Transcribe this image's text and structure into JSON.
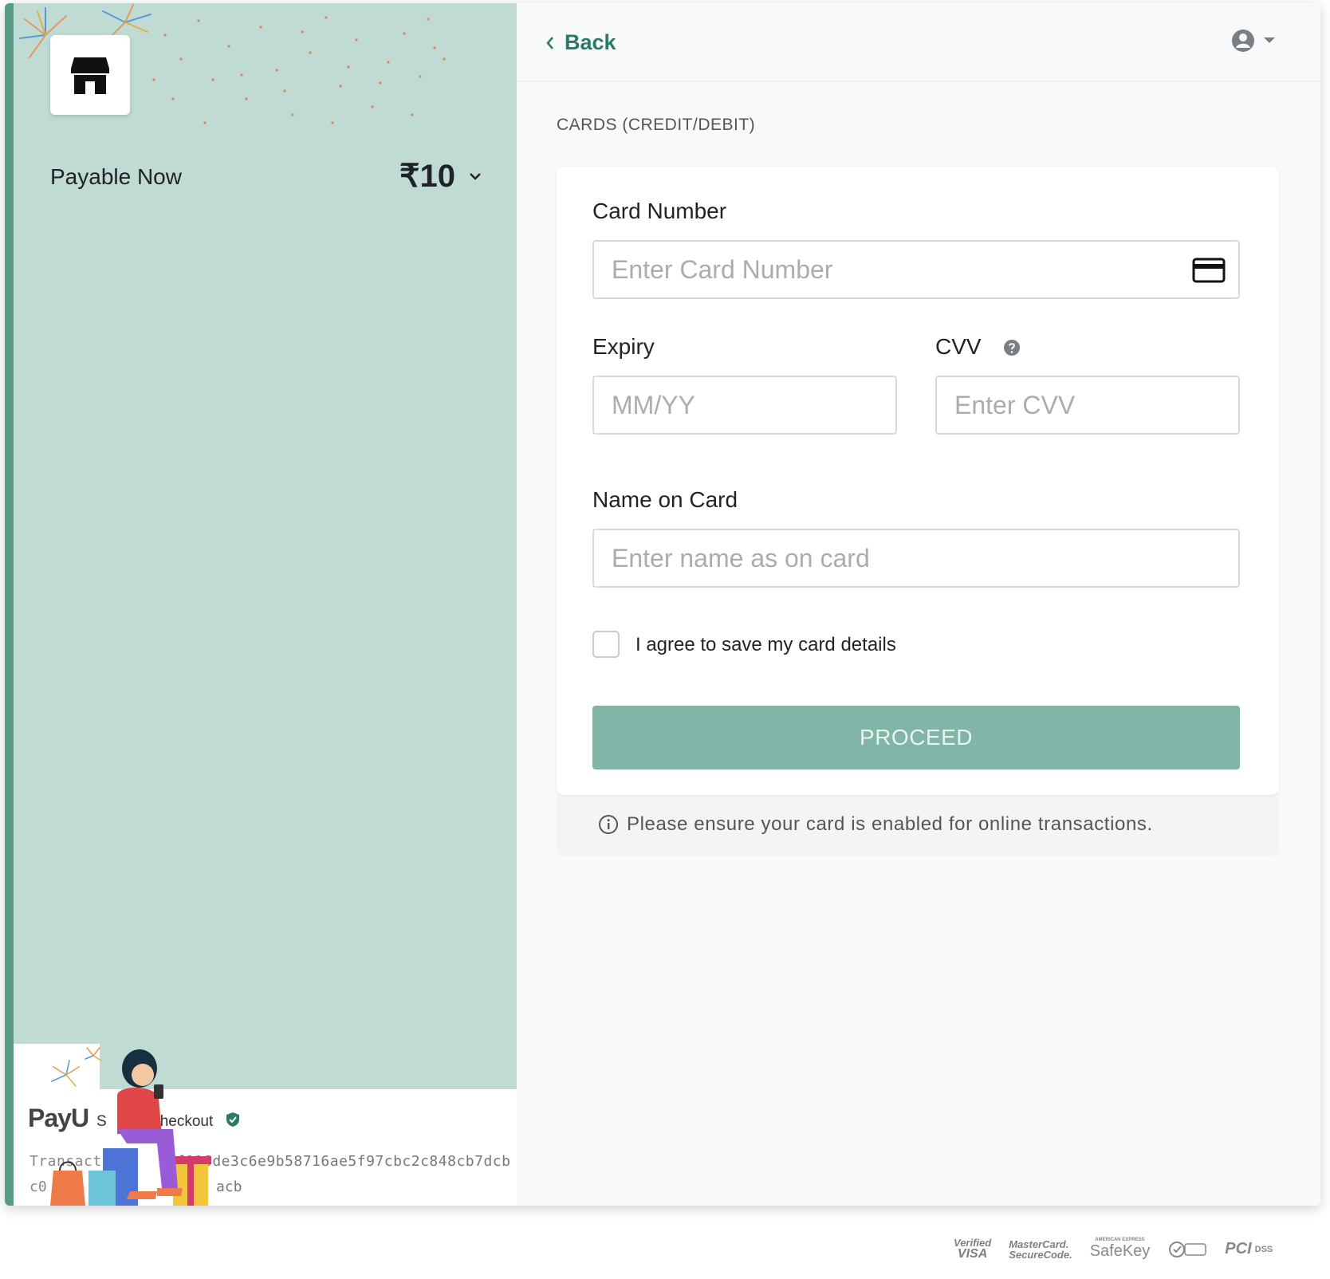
{
  "summary": {
    "payable_label": "Payable Now",
    "amount": "₹10",
    "merchant_icon": "store-icon",
    "expand_icon": "chevron-down-icon"
  },
  "footer": {
    "brand": "PayU",
    "checkout_prefix": "S",
    "checkout_label": "Checkout",
    "transaction_prefix": "Transact",
    "transaction_id_part1": "f016de3c6e9b58716ae5f97cbc2c848cb7dcb",
    "transaction_prefix2": "c0",
    "transaction_id_part2": "acb"
  },
  "header": {
    "back_label": "Back",
    "user_icon": "user-circle-icon"
  },
  "section_title": "CARDS (CREDIT/DEBIT)",
  "form": {
    "card_number_label": "Card Number",
    "card_number_placeholder": "Enter Card Number",
    "expiry_label": "Expiry",
    "expiry_placeholder": "MM/YY",
    "cvv_label": "CVV",
    "cvv_placeholder": "Enter CVV",
    "name_label": "Name on Card",
    "name_placeholder": "Enter name as on card",
    "save_card_label": "I agree to save my card details",
    "proceed_label": "PROCEED"
  },
  "note": "Please ensure your card is enabled for online transactions.",
  "security_badges": {
    "visa_line1": "Verified",
    "visa_line2": "VISA",
    "mc_line1": "MasterCard.",
    "mc_line2": "SecureCode.",
    "safekey_small": "AMERICAN EXPRESS",
    "safekey": "SafeKey",
    "pci": "PCI",
    "dss": "DSS"
  },
  "colors": {
    "accent": "#2b7a65",
    "left_panel": "#bfdbd4",
    "proceed_button": "#80b5a7"
  }
}
